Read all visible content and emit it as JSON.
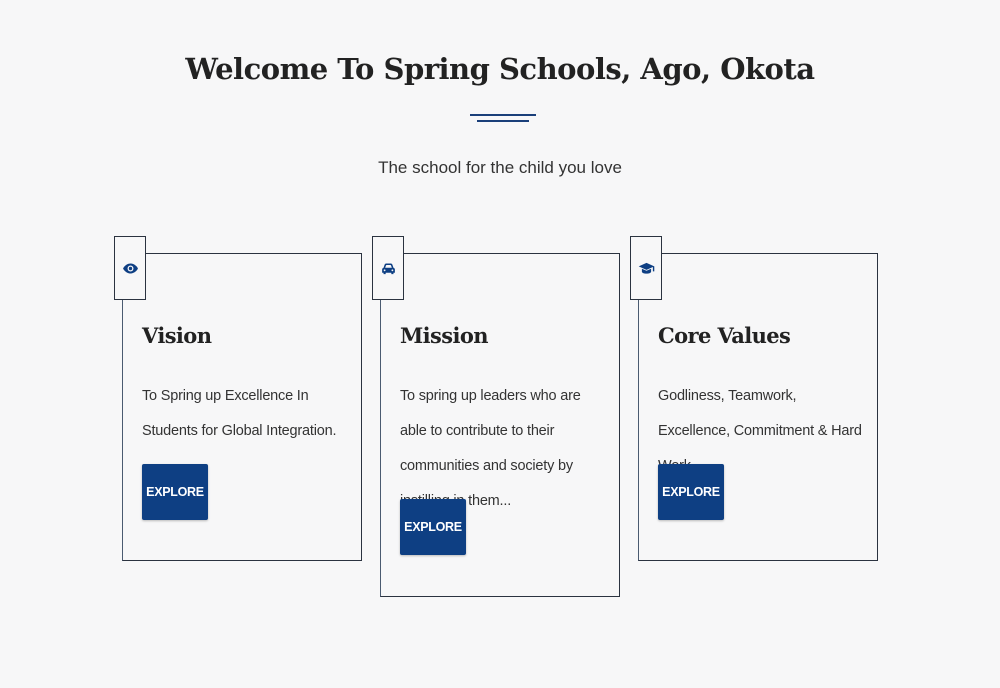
{
  "header": {
    "title": "Welcome To Spring Schools, Ago, Okota",
    "subtitle": "The school for the child you love"
  },
  "colors": {
    "accent": "#0e3f83",
    "frame": "#2b3340",
    "background": "#f7f7f8"
  },
  "cards": [
    {
      "icon": "eye-icon",
      "heading": "Vision",
      "text": "To Spring up Excellence In Students for Global Integration.",
      "button_label": "EXPLORE"
    },
    {
      "icon": "car-icon",
      "heading": "Mission",
      "text": "To spring up leaders who are able to contribute to their communities and society by instilling in them...",
      "button_label": "EXPLORE"
    },
    {
      "icon": "graduation-cap-icon",
      "heading": "Core Values",
      "text": "Godliness, Teamwork, Excellence, Commitment & Hard Work",
      "button_label": "EXPLORE"
    }
  ]
}
